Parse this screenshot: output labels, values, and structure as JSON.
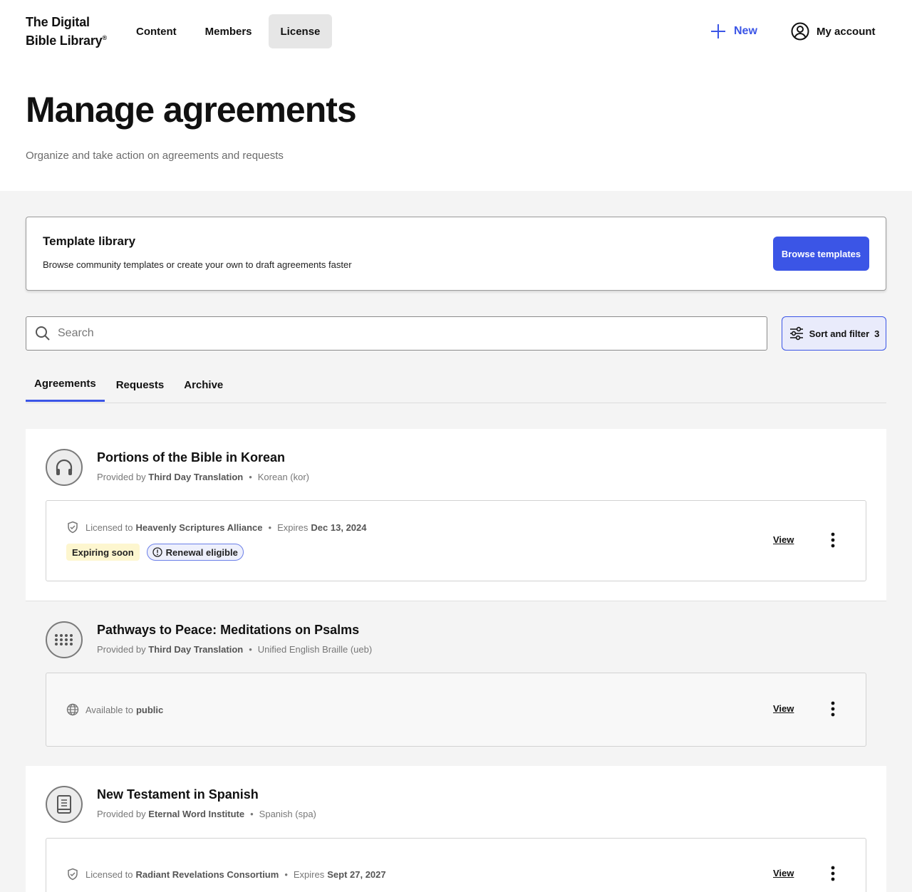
{
  "nav": {
    "logo_line1": "The Digital",
    "logo_line2": "Bible Library",
    "logo_mark": "®",
    "links": [
      {
        "label": "Content"
      },
      {
        "label": "Members"
      },
      {
        "label": "License",
        "active": true
      }
    ],
    "new_label": "New",
    "account_label": "My account"
  },
  "header": {
    "title": "Manage agreements",
    "subtitle": "Organize and take action on agreements and requests"
  },
  "template_library": {
    "title": "Template library",
    "description": "Browse community templates or create your own to draft agreements faster",
    "button_label": "Browse templates"
  },
  "search": {
    "placeholder": "Search",
    "value": ""
  },
  "sort_filter": {
    "label": "Sort and filter",
    "count": "3"
  },
  "tabs": [
    {
      "label": "Agreements",
      "active": true
    },
    {
      "label": "Requests"
    },
    {
      "label": "Archive"
    }
  ],
  "agreements": [
    {
      "title": "Portions of the Bible in Korean",
      "provided_prefix": "Provided by",
      "provider": "Third Day Translation",
      "language": "Korean (kor)",
      "icon": "headphones-icon",
      "license_prefix": "Licensed to",
      "licensee": "Heavenly Scriptures Alliance",
      "expires_prefix": "Expires",
      "expires": "Dec 13, 2024",
      "badges": {
        "expiring": "Expiring soon",
        "renewal": "Renewal eligible"
      },
      "view_label": "View"
    },
    {
      "title": "Pathways to Peace: Meditations on Psalms",
      "provided_prefix": "Provided by",
      "provider": "Third Day Translation",
      "language": "Unified English Braille (ueb)",
      "icon": "braille-icon",
      "license_prefix": "Available to",
      "licensee": "public",
      "view_label": "View"
    },
    {
      "title": "New Testament in Spanish",
      "provided_prefix": "Provided by",
      "provider": "Eternal Word Institute",
      "language": "Spanish (spa)",
      "icon": "book-icon",
      "license_prefix": "Licensed to",
      "licensee": "Radiant Revelations Consortium",
      "expires_prefix": "Expires",
      "expires": "Sept 27, 2027",
      "view_label": "View"
    }
  ],
  "colors": {
    "accent": "#3b55e6",
    "page_bg": "#f4f4f4",
    "expiring_badge": "#fdf6cf"
  }
}
